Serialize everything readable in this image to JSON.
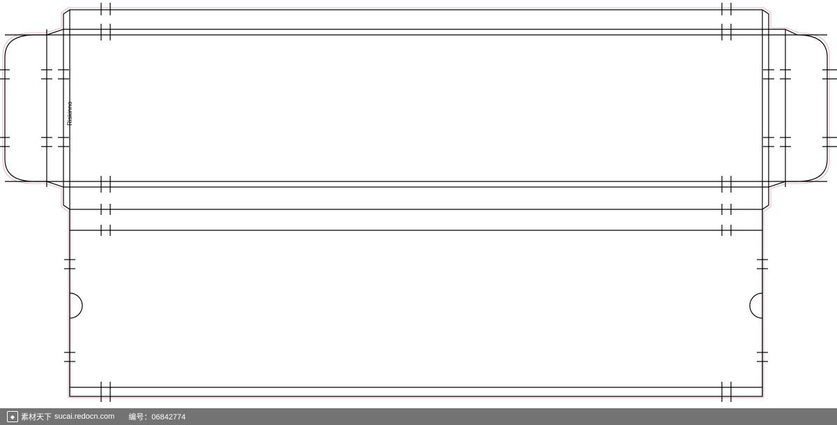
{
  "brand": {
    "label": "Riskinno"
  },
  "footer": {
    "site_label": "素材天下",
    "site_url": "sucai.redocn.com",
    "id_label": "编号：",
    "id_value": "06842774"
  },
  "dieline": {
    "type": "box-template",
    "registration_marks": true,
    "outline_color": "#000000",
    "bleed_color": "#e8a0b0"
  }
}
